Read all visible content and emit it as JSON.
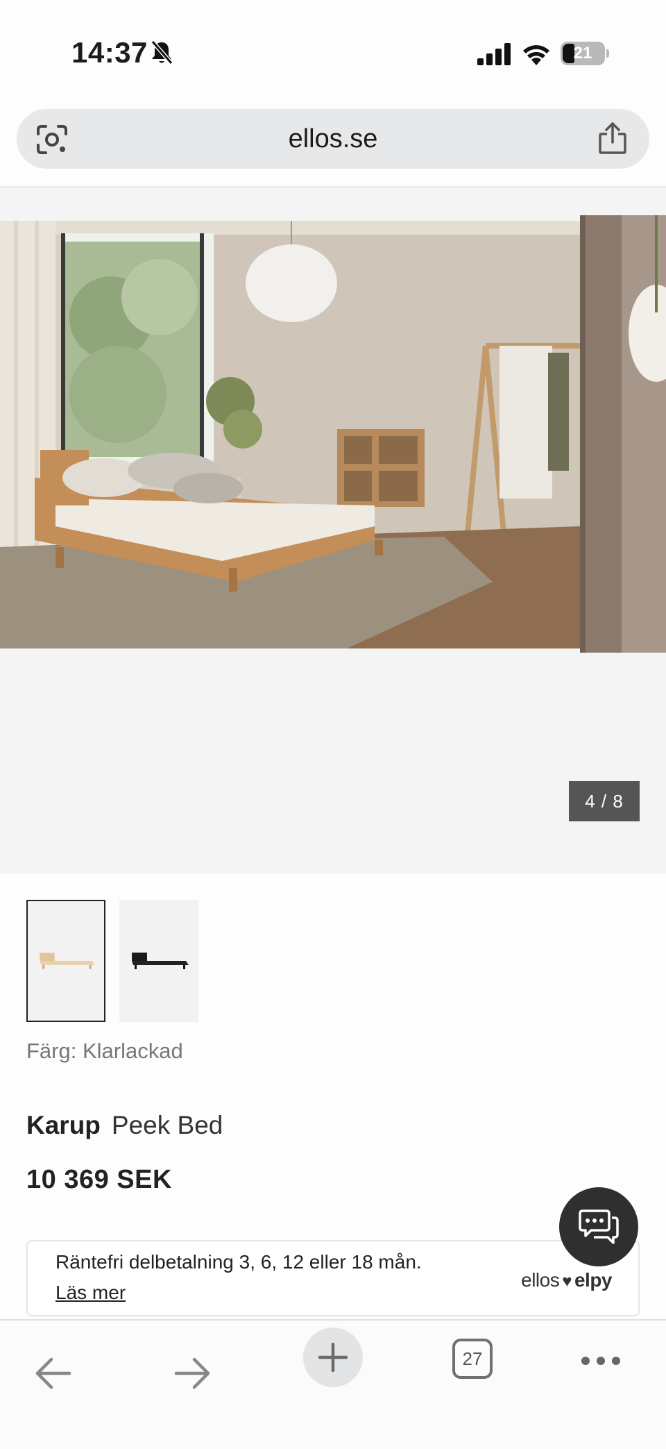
{
  "status_bar": {
    "time": "14:37",
    "battery": "21"
  },
  "address_bar": {
    "url": "ellos.se"
  },
  "gallery": {
    "counter": "4 / 8"
  },
  "product": {
    "color_label": "Färg: Klarlackad",
    "brand": "Karup",
    "name": "Peek Bed",
    "price": "10 369 SEK"
  },
  "finance": {
    "text": "Räntefri delbetalning 3, 6, 12 eller 18 mån.",
    "link": "Läs mer",
    "logo_left": "ellos",
    "logo_right": "elpy"
  },
  "toolbar": {
    "tab_count": "27"
  },
  "icons": [
    "bell-off-icon",
    "signal-icon",
    "wifi-icon",
    "battery-icon",
    "google-lens-icon",
    "share-icon",
    "chat-icon",
    "back-arrow-icon",
    "forward-arrow-icon",
    "plus-icon",
    "tabs-icon",
    "more-icon"
  ]
}
